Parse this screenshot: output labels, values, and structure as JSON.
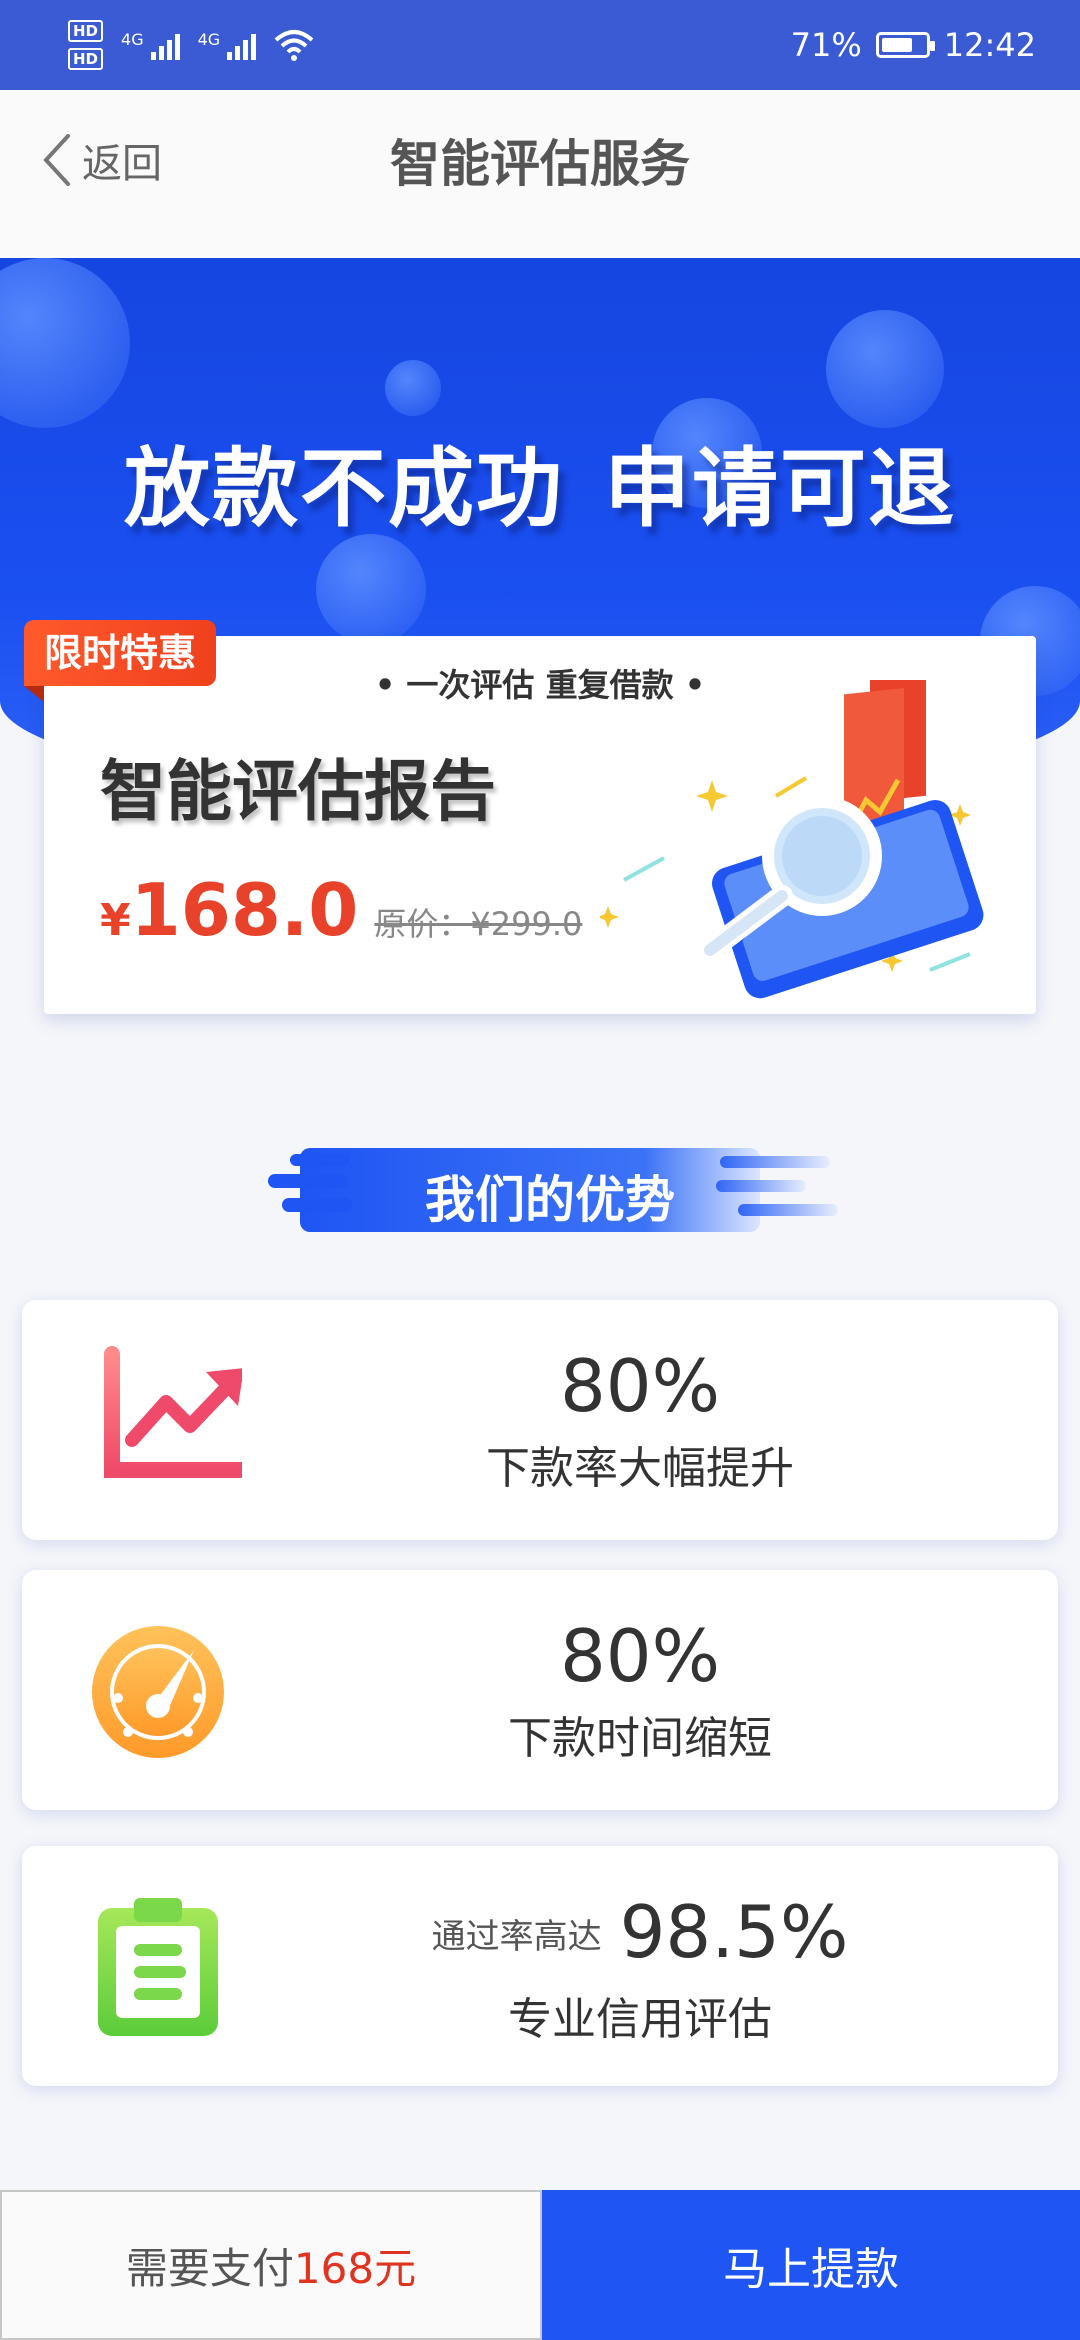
{
  "status_bar": {
    "hd1": "HD",
    "hd2": "HD",
    "network1": "4G",
    "network2": "4G",
    "battery_percent": "71%",
    "battery_level": 0.71,
    "time": "12:42"
  },
  "nav": {
    "back_label": "返回",
    "title": "智能评估服务"
  },
  "hero": {
    "slogan_left": "放款不成功",
    "slogan_right": "申请可退"
  },
  "report": {
    "promo_tag": "限时特惠",
    "subtitle": "• 一次评估 重复借款 •",
    "title": "智能评估报告",
    "currency": "¥",
    "price": "168.0",
    "original_price": "原价：¥299.0"
  },
  "advantages": {
    "title": "我们的优势",
    "items": [
      {
        "icon": "trend-up-icon",
        "prefix": "",
        "value": "80%",
        "label": "下款率大幅提升"
      },
      {
        "icon": "speedometer-icon",
        "prefix": "",
        "value": "80%",
        "label": "下款时间缩短"
      },
      {
        "icon": "clipboard-icon",
        "prefix": "通过率高达",
        "value": "98.5%",
        "label": "专业信用评估"
      }
    ]
  },
  "bottom_bar": {
    "pay_prefix": "需要支付",
    "pay_amount": "168元",
    "withdraw_label": "马上提款"
  },
  "colors": {
    "brand_blue": "#1f55f3",
    "status_bar": "#3a5bd4",
    "price_red": "#e8422a",
    "promo_orange": "#ff5a2c"
  }
}
